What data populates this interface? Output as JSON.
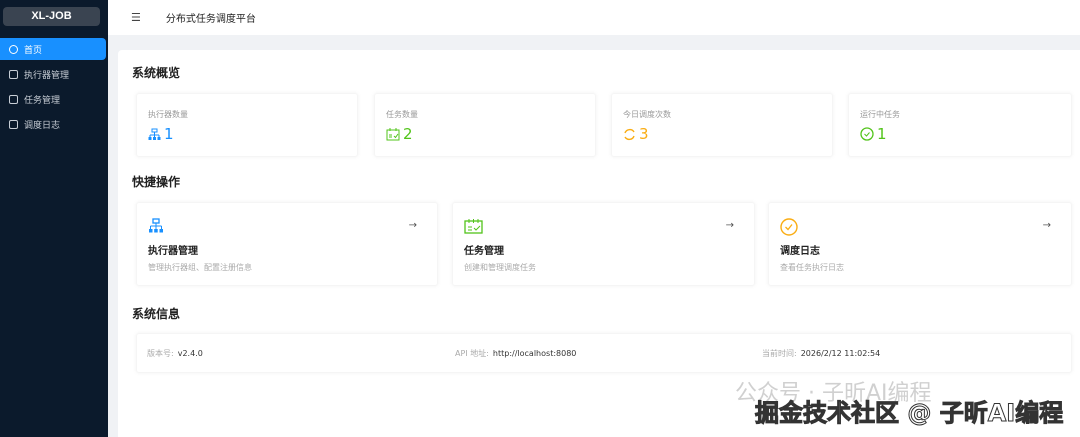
{
  "app": {
    "logo": "XL-JOB",
    "title": "分布式任务调度平台"
  },
  "sidebar": {
    "items": [
      {
        "label": "首页",
        "icon": "dashboard-icon",
        "active": true
      },
      {
        "label": "执行器管理",
        "icon": "cluster-icon"
      },
      {
        "label": "任务管理",
        "icon": "schedule-icon"
      },
      {
        "label": "调度日志",
        "icon": "file-icon"
      }
    ]
  },
  "overview": {
    "title": "系统概览",
    "stats": [
      {
        "label": "执行器数量",
        "value": "1",
        "icon": "cluster-icon",
        "color": "#1890ff"
      },
      {
        "label": "任务数量",
        "value": "2",
        "icon": "schedule-icon",
        "color": "#52c41a"
      },
      {
        "label": "今日调度次数",
        "value": "3",
        "icon": "sync-icon",
        "color": "#faad14"
      },
      {
        "label": "运行中任务",
        "value": "1",
        "icon": "check-circle-icon",
        "color": "#52c41a"
      }
    ]
  },
  "quick": {
    "title": "快捷操作",
    "items": [
      {
        "title": "执行器管理",
        "desc": "管理执行器组、配置注册信息",
        "icon": "cluster-icon",
        "color": "#1890ff"
      },
      {
        "title": "任务管理",
        "desc": "创建和管理调度任务",
        "icon": "schedule-icon",
        "color": "#52c41a"
      },
      {
        "title": "调度日志",
        "desc": "查看任务执行日志",
        "icon": "check-circle-icon",
        "color": "#faad14"
      }
    ]
  },
  "sysinfo": {
    "title": "系统信息",
    "version_label": "版本号:",
    "version": "v2.4.0",
    "api_label": "API 地址:",
    "api": "http://localhost:8080",
    "time_label": "当前时间:",
    "time": "2026/2/12 11:02:54"
  },
  "watermark": {
    "line1": "公众号 · 子昕AI编程",
    "line2": "掘金技术社区 @ 子昕AI编程"
  }
}
